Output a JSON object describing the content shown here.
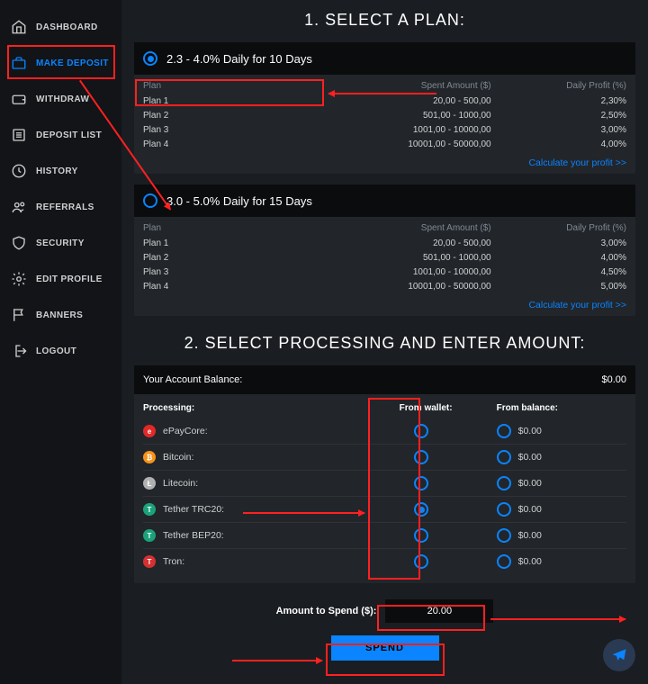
{
  "sidebar": {
    "items": [
      {
        "label": "DASHBOARD"
      },
      {
        "label": "MAKE DEPOSIT"
      },
      {
        "label": "WITHDRAW"
      },
      {
        "label": "DEPOSIT LIST"
      },
      {
        "label": "HISTORY"
      },
      {
        "label": "REFERRALS"
      },
      {
        "label": "SECURITY"
      },
      {
        "label": "EDIT PROFILE"
      },
      {
        "label": "BANNERS"
      },
      {
        "label": "LOGOUT"
      }
    ]
  },
  "headings": {
    "step1": "1. SELECT A PLAN:",
    "step2": "2. SELECT PROCESSING AND ENTER AMOUNT:"
  },
  "plan_table_headers": {
    "plan": "Plan",
    "amount": "Spent Amount ($)",
    "profit": "Daily Profit (%)"
  },
  "calc_link": "Calculate your profit >>",
  "plans": [
    {
      "title": "2.3 - 4.0% Daily for 10 Days",
      "selected": true,
      "rows": [
        {
          "plan": "Plan 1",
          "amount": "20,00 - 500,00",
          "profit": "2,30%"
        },
        {
          "plan": "Plan 2",
          "amount": "501,00 - 1000,00",
          "profit": "2,50%"
        },
        {
          "plan": "Plan 3",
          "amount": "1001,00 - 10000,00",
          "profit": "3,00%"
        },
        {
          "plan": "Plan 4",
          "amount": "10001,00 - 50000,00",
          "profit": "4,00%"
        }
      ]
    },
    {
      "title": "3.0 - 5.0% Daily for 15 Days",
      "selected": false,
      "rows": [
        {
          "plan": "Plan 1",
          "amount": "20,00 - 500,00",
          "profit": "3,00%"
        },
        {
          "plan": "Plan 2",
          "amount": "501,00 - 1000,00",
          "profit": "4,00%"
        },
        {
          "plan": "Plan 3",
          "amount": "1001,00 - 10000,00",
          "profit": "4,50%"
        },
        {
          "plan": "Plan 4",
          "amount": "10001,00 - 50000,00",
          "profit": "5,00%"
        }
      ]
    }
  ],
  "processing": {
    "balance_label": "Your Account Balance:",
    "balance_value": "$0.00",
    "headers": {
      "proc": "Processing:",
      "wallet": "From wallet:",
      "balance": "From balance:"
    },
    "rows": [
      {
        "name": "ePayCore:",
        "color": "#e32828",
        "glyph": "e",
        "wallet_checked": false,
        "balance": "$0.00"
      },
      {
        "name": "Bitcoin:",
        "color": "#f7931a",
        "glyph": "₿",
        "wallet_checked": false,
        "balance": "$0.00"
      },
      {
        "name": "Litecoin:",
        "color": "#b0b0b0",
        "glyph": "Ł",
        "wallet_checked": false,
        "balance": "$0.00"
      },
      {
        "name": "Tether TRC20:",
        "color": "#1ba27a",
        "glyph": "T",
        "wallet_checked": true,
        "balance": "$0.00"
      },
      {
        "name": "Tether BEP20:",
        "color": "#1ba27a",
        "glyph": "T",
        "wallet_checked": false,
        "balance": "$0.00"
      },
      {
        "name": "Tron:",
        "color": "#d63031",
        "glyph": "T",
        "wallet_checked": false,
        "balance": "$0.00"
      }
    ]
  },
  "amount": {
    "label": "Amount to Spend ($):",
    "value": "20.00"
  },
  "spend_label": "SPEND"
}
